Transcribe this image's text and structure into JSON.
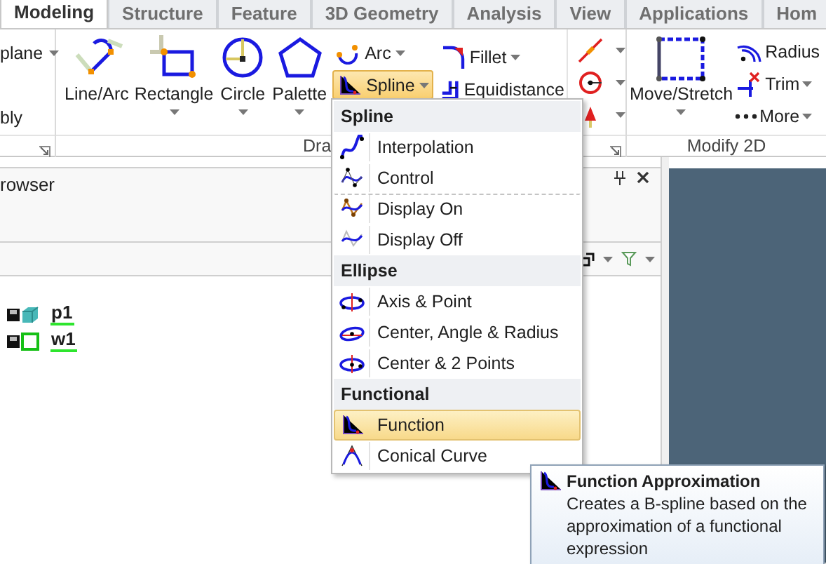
{
  "tabs": [
    {
      "label": "Modeling",
      "selected": true
    },
    {
      "label": "Structure",
      "selected": false
    },
    {
      "label": "Feature",
      "selected": false
    },
    {
      "label": "3D Geometry",
      "selected": false
    },
    {
      "label": "Analysis",
      "selected": false
    },
    {
      "label": "View",
      "selected": false
    },
    {
      "label": "Applications",
      "selected": false
    },
    {
      "label": "Hom",
      "selected": false
    }
  ],
  "ribbon": {
    "cut_group": {
      "items": [
        {
          "label": "plane",
          "dropdown": true
        },
        {
          "label": "bly",
          "dropdown": false
        }
      ]
    },
    "draw_group": {
      "label": "Dra",
      "large_buttons": [
        {
          "label": "Line/Arc",
          "dropdown": false
        },
        {
          "label": "Rectangle",
          "dropdown": true
        },
        {
          "label": "Circle",
          "dropdown": true
        },
        {
          "label": "Palette",
          "dropdown": true
        }
      ],
      "small_buttons": [
        {
          "label": "Arc",
          "dropdown": true,
          "highlighted": false
        },
        {
          "label": "Spline",
          "dropdown": true,
          "highlighted": true
        },
        {
          "label": "Fillet",
          "dropdown": true,
          "highlighted": false
        },
        {
          "label": "Equidistance",
          "dropdown": false,
          "highlighted": false
        }
      ]
    },
    "modify_group": {
      "label": "Modify 2D",
      "large_buttons": [
        {
          "label": "Move/Stretch",
          "dropdown": true
        }
      ],
      "small_buttons": [
        {
          "label": "Radius"
        },
        {
          "label": "Trim",
          "dropdown": true
        },
        {
          "label": "More",
          "dropdown": true
        }
      ]
    }
  },
  "panel": {
    "title": "rowser",
    "tree": [
      {
        "label": "p1"
      },
      {
        "label": "w1"
      }
    ]
  },
  "menu": {
    "sections": [
      {
        "header": "Spline",
        "items": [
          {
            "label": "Interpolation",
            "selected": false,
            "divider_before": false
          },
          {
            "label": "Control",
            "selected": false,
            "divider_before": false
          },
          {
            "label": "Display On",
            "selected": false,
            "divider_before": true
          },
          {
            "label": "Display Off",
            "selected": false,
            "divider_before": false
          }
        ]
      },
      {
        "header": "Ellipse",
        "items": [
          {
            "label": "Axis & Point",
            "selected": false,
            "divider_before": false
          },
          {
            "label": "Center, Angle & Radius",
            "selected": false,
            "divider_before": false
          },
          {
            "label": "Center & 2 Points",
            "selected": false,
            "divider_before": false
          }
        ]
      },
      {
        "header": "Functional",
        "items": [
          {
            "label": "Function",
            "selected": true,
            "divider_before": false
          },
          {
            "label": "Conical Curve",
            "selected": false,
            "divider_before": false
          }
        ]
      }
    ]
  },
  "tooltip": {
    "title": "Function Approximation",
    "text": "Creates a B-spline based on the approximation of a functional expression"
  }
}
